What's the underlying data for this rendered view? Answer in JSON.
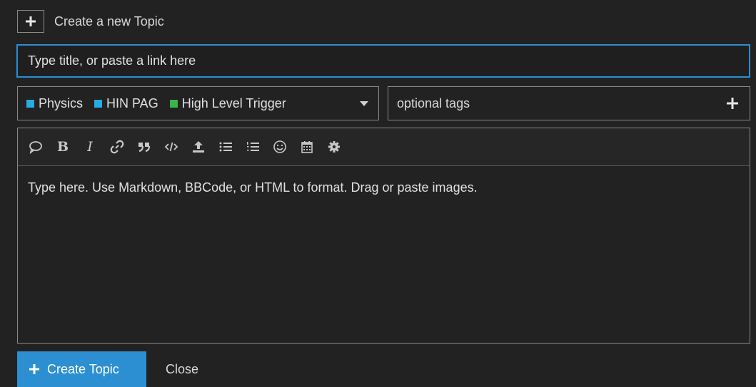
{
  "header": {
    "title": "Create a new Topic",
    "icon": "plus-icon"
  },
  "title_field": {
    "placeholder": "Type title, or paste a link here",
    "value": ""
  },
  "categories": [
    {
      "label": "Physics",
      "color": "#29abe2"
    },
    {
      "label": "HIN PAG",
      "color": "#29abe2"
    },
    {
      "label": "High Level Trigger",
      "color": "#3ab54a"
    }
  ],
  "tags": {
    "placeholder": "optional tags"
  },
  "toolbar": [
    "quote-icon",
    "bold-icon",
    "italic-icon",
    "link-icon",
    "blockquote-icon",
    "code-icon",
    "upload-icon",
    "bullet-list-icon",
    "numbered-list-icon",
    "emoji-icon",
    "calendar-icon",
    "gear-icon"
  ],
  "editor": {
    "placeholder": "Type here. Use Markdown, BBCode, or HTML to format. Drag or paste images."
  },
  "footer": {
    "create_label": "Create Topic",
    "close_label": "Close"
  },
  "colors": {
    "accent": "#2b8fd1",
    "background": "#222222"
  }
}
